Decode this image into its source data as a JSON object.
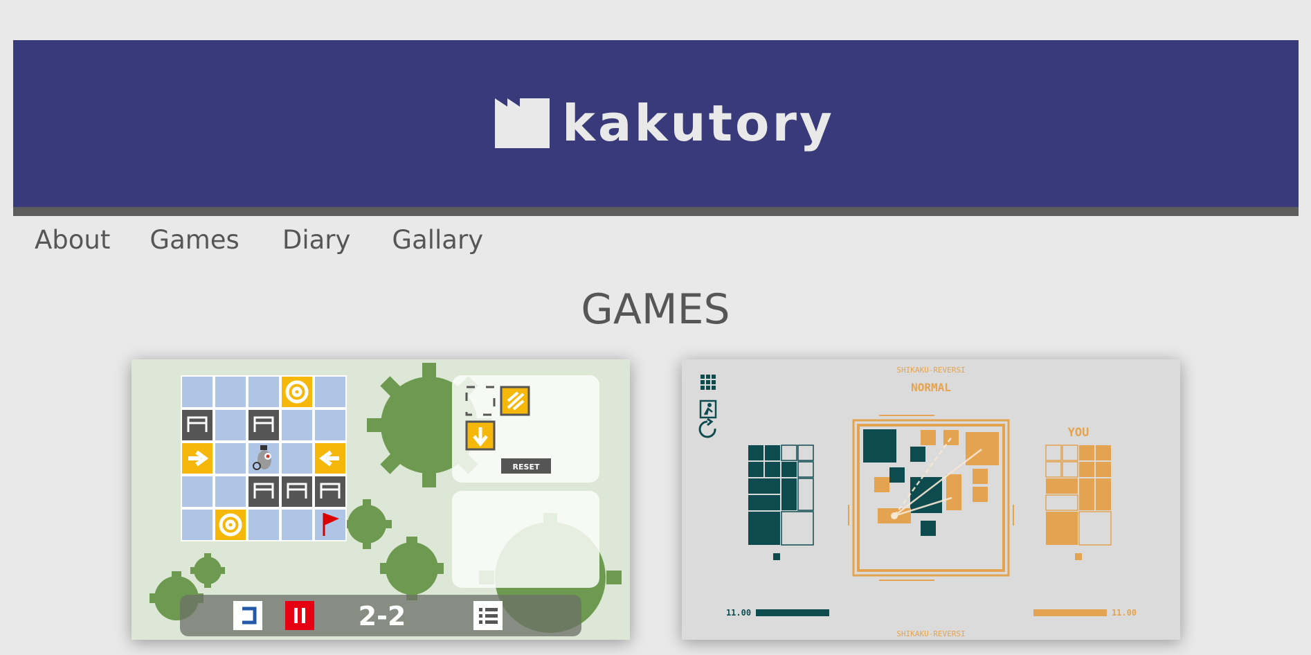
{
  "site": {
    "name": "kakutory"
  },
  "nav": {
    "items": [
      "About",
      "Games",
      "Diary",
      "Gallary"
    ]
  },
  "page": {
    "title": "GAMES"
  },
  "games": [
    {
      "controls": {
        "reset_label": "RESET",
        "level": "2-2"
      }
    },
    {
      "title_top": "SHIKAKU-REVERSI",
      "difficulty": "NORMAL",
      "player_label": "YOU",
      "score_left": "11.00",
      "score_right": "11.00",
      "title_bottom": "SHIKAKU-REVERSI",
      "colors": {
        "teal": "#0e4b4f",
        "orange": "#e3a351"
      }
    }
  ],
  "colors": {
    "header": "#383a79",
    "header_bar": "#5d5d5d",
    "background": "#e9e9e9",
    "text": "#565656"
  }
}
